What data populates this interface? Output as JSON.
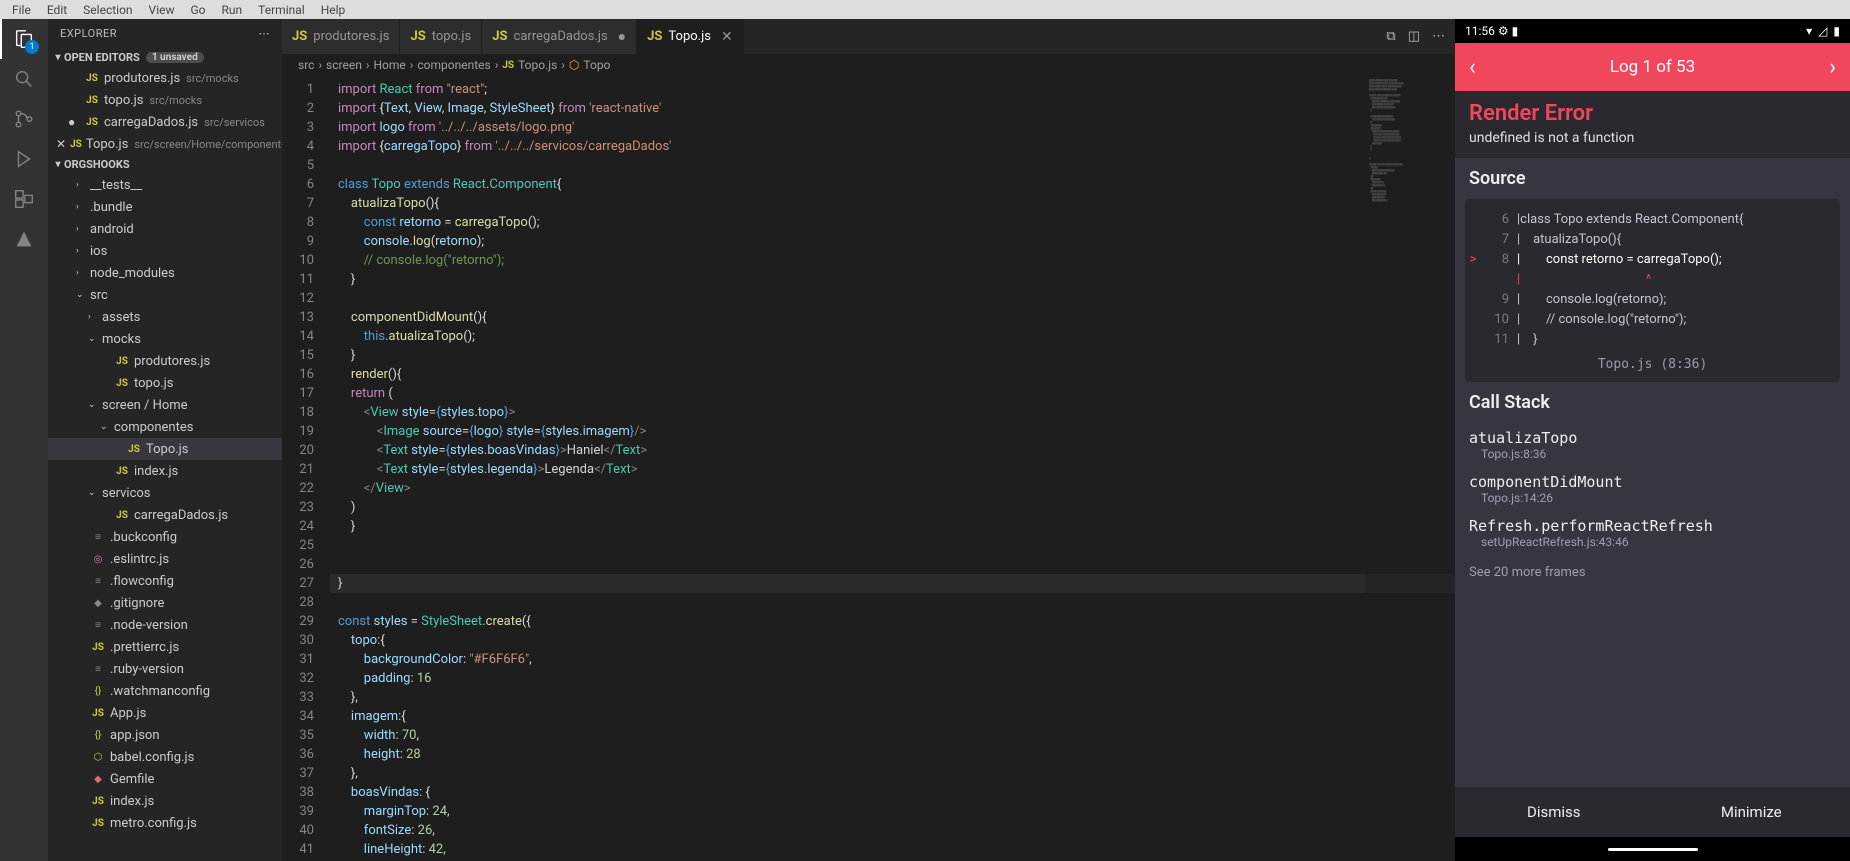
{
  "menu": [
    "File",
    "Edit",
    "Selection",
    "View",
    "Go",
    "Run",
    "Terminal",
    "Help"
  ],
  "activity_badge": "1",
  "sidebar": {
    "title": "EXPLORER",
    "open_editors_label": "OPEN EDITORS",
    "unsaved_label": "1 unsaved",
    "open_editors": [
      {
        "name": "produtores.js",
        "path": "src/mocks",
        "icon": "JS",
        "modified": false
      },
      {
        "name": "topo.js",
        "path": "src/mocks",
        "icon": "JS",
        "modified": false
      },
      {
        "name": "carregaDados.js",
        "path": "src/servicos",
        "icon": "JS",
        "modified": true
      },
      {
        "name": "Topo.js",
        "path": "src/screen/Home/componentes",
        "icon": "JS",
        "modified": false,
        "close": true
      }
    ],
    "workspace": "ORGSHOOKS",
    "tree": [
      {
        "type": "folder",
        "name": "__tests__",
        "depth": 1,
        "open": false
      },
      {
        "type": "folder",
        "name": ".bundle",
        "depth": 1,
        "open": false
      },
      {
        "type": "folder",
        "name": "android",
        "depth": 1,
        "open": false
      },
      {
        "type": "folder",
        "name": "ios",
        "depth": 1,
        "open": false
      },
      {
        "type": "folder",
        "name": "node_modules",
        "depth": 1,
        "open": false
      },
      {
        "type": "folder",
        "name": "src",
        "depth": 1,
        "open": true
      },
      {
        "type": "folder",
        "name": "assets",
        "depth": 2,
        "open": false
      },
      {
        "type": "folder",
        "name": "mocks",
        "depth": 2,
        "open": true
      },
      {
        "type": "file",
        "name": "produtores.js",
        "depth": 3,
        "icon": "JS"
      },
      {
        "type": "file",
        "name": "topo.js",
        "depth": 3,
        "icon": "JS"
      },
      {
        "type": "folder",
        "name": "screen / Home",
        "depth": 2,
        "open": true
      },
      {
        "type": "folder",
        "name": "componentes",
        "depth": 3,
        "open": true
      },
      {
        "type": "file",
        "name": "Topo.js",
        "depth": 4,
        "icon": "JS",
        "active": true
      },
      {
        "type": "file",
        "name": "index.js",
        "depth": 3,
        "icon": "JS"
      },
      {
        "type": "folder",
        "name": "servicos",
        "depth": 2,
        "open": true
      },
      {
        "type": "file",
        "name": "carregaDados.js",
        "depth": 3,
        "icon": "JS"
      },
      {
        "type": "file",
        "name": ".buckconfig",
        "depth": 1,
        "icon": "≡",
        "iconClass": "config-icon"
      },
      {
        "type": "file",
        "name": ".eslintrc.js",
        "depth": 1,
        "icon": "◎",
        "iconClass": "purple-icon"
      },
      {
        "type": "file",
        "name": ".flowconfig",
        "depth": 1,
        "icon": "≡",
        "iconClass": "config-icon"
      },
      {
        "type": "file",
        "name": ".gitignore",
        "depth": 1,
        "icon": "◆",
        "iconClass": "config-icon"
      },
      {
        "type": "file",
        "name": ".node-version",
        "depth": 1,
        "icon": "≡",
        "iconClass": "config-icon"
      },
      {
        "type": "file",
        "name": ".prettierrc.js",
        "depth": 1,
        "icon": "JS"
      },
      {
        "type": "file",
        "name": ".ruby-version",
        "depth": 1,
        "icon": "≡",
        "iconClass": "config-icon"
      },
      {
        "type": "file",
        "name": ".watchmanconfig",
        "depth": 1,
        "icon": "{}",
        "iconClass": "yellow-icon"
      },
      {
        "type": "file",
        "name": "App.js",
        "depth": 1,
        "icon": "JS"
      },
      {
        "type": "file",
        "name": "app.json",
        "depth": 1,
        "icon": "{}",
        "iconClass": "yellow-icon"
      },
      {
        "type": "file",
        "name": "babel.config.js",
        "depth": 1,
        "icon": "⬡",
        "iconClass": "yellow-icon"
      },
      {
        "type": "file",
        "name": "Gemfile",
        "depth": 1,
        "icon": "◆",
        "iconClass": "red-icon"
      },
      {
        "type": "file",
        "name": "index.js",
        "depth": 1,
        "icon": "JS"
      },
      {
        "type": "file",
        "name": "metro.config.js",
        "depth": 1,
        "icon": "JS"
      }
    ]
  },
  "tabs": [
    {
      "name": "produtores.js",
      "icon": "JS",
      "active": false
    },
    {
      "name": "topo.js",
      "icon": "JS",
      "active": false
    },
    {
      "name": "carregaDados.js",
      "icon": "JS",
      "active": false,
      "modified": true
    },
    {
      "name": "Topo.js",
      "icon": "JS",
      "active": true,
      "close": true
    }
  ],
  "breadcrumb": [
    "src",
    "screen",
    "Home",
    "componentes",
    "Topo.js",
    "Topo"
  ],
  "editor": {
    "lines": 41,
    "highlighted": 27
  },
  "emulator": {
    "time": "11:56",
    "log_header": "Log 1 of 53",
    "title": "Render Error",
    "message": "undefined is not a function",
    "source_label": "Source",
    "source_lines": [
      {
        "n": "6",
        "marker": "",
        "code": "|class Topo extends React.Component{"
      },
      {
        "n": "7",
        "marker": "",
        "code": "|    atualizaTopo(){"
      },
      {
        "n": "8",
        "marker": ">",
        "code": "|        const retorno = carregaTopo();",
        "hl": true
      },
      {
        "n": "",
        "marker": "",
        "code": "|                                       ^",
        "pointer": true
      },
      {
        "n": "9",
        "marker": "",
        "code": "|        console.log(retorno);"
      },
      {
        "n": "10",
        "marker": "",
        "code": "|        // console.log(\"retorno\");"
      },
      {
        "n": "11",
        "marker": "",
        "code": "|    }"
      }
    ],
    "source_file": "Topo.js (8:36)",
    "callstack_label": "Call Stack",
    "callstack": [
      {
        "fn": "atualizaTopo",
        "loc": "Topo.js:8:36"
      },
      {
        "fn": "componentDidMount",
        "loc": "Topo.js:14:26"
      },
      {
        "fn": "Refresh.performReactRefresh",
        "loc": "setUpReactRefresh.js:43:46"
      }
    ],
    "see_more": "See 20 more frames",
    "dismiss": "Dismiss",
    "minimize": "Minimize"
  }
}
